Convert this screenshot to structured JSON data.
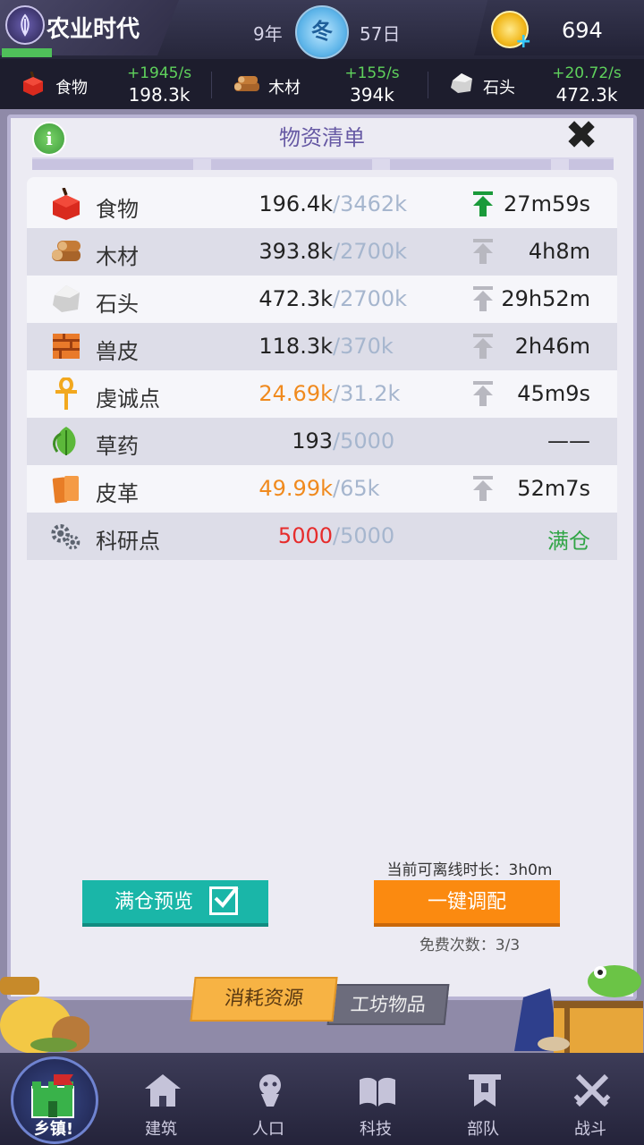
{
  "header": {
    "era_name": "农业时代",
    "year": "9年",
    "season": "冬",
    "day": "57日",
    "gold": "694"
  },
  "resources": [
    {
      "name": "食物",
      "rate": "+1945/s",
      "amount": "198.3k",
      "icon": "apple-icon"
    },
    {
      "name": "木材",
      "rate": "+155/s",
      "amount": "394k",
      "icon": "wood-icon"
    },
    {
      "name": "石头",
      "rate": "+20.72/s",
      "amount": "472.3k",
      "icon": "stone-icon"
    }
  ],
  "panel": {
    "title": "物资清单",
    "items": [
      {
        "name": "食物",
        "current": "196.4k",
        "max": "/3462k",
        "time": "27m59s"
      },
      {
        "name": "木材",
        "current": "393.8k",
        "max": "/2700k",
        "time": "4h8m"
      },
      {
        "name": "石头",
        "current": "472.3k",
        "max": "/2700k",
        "time": "29h52m"
      },
      {
        "name": "兽皮",
        "current": "118.3k",
        "max": "/370k",
        "time": "2h46m"
      },
      {
        "name": "虔诚点",
        "current": "24.69k",
        "max": "/31.2k",
        "time": "45m9s"
      },
      {
        "name": "草药",
        "current": "193",
        "max": "/5000",
        "time": "——"
      },
      {
        "name": "皮革",
        "current": "49.99k",
        "max": "/65k",
        "time": "52m7s"
      },
      {
        "name": "科研点",
        "current": "5000",
        "max": "/5000",
        "time": "满仓"
      }
    ],
    "offline_time": "当前可离线时长：3h0m",
    "full_preview_label": "满仓预览",
    "one_click_label": "一键调配",
    "free_count": "免费次数：3/3",
    "tab_consume": "消耗资源",
    "tab_workshop": "工坊物品"
  },
  "nav": [
    {
      "label": "乡镇!"
    },
    {
      "label": "建筑"
    },
    {
      "label": "人口"
    },
    {
      "label": "科技"
    },
    {
      "label": "部队"
    },
    {
      "label": "战斗"
    }
  ],
  "colors": {
    "accent_green": "#31a546",
    "orange": "#fb8a10",
    "teal": "#1ab6a8",
    "warning_red": "#e62c2c"
  }
}
